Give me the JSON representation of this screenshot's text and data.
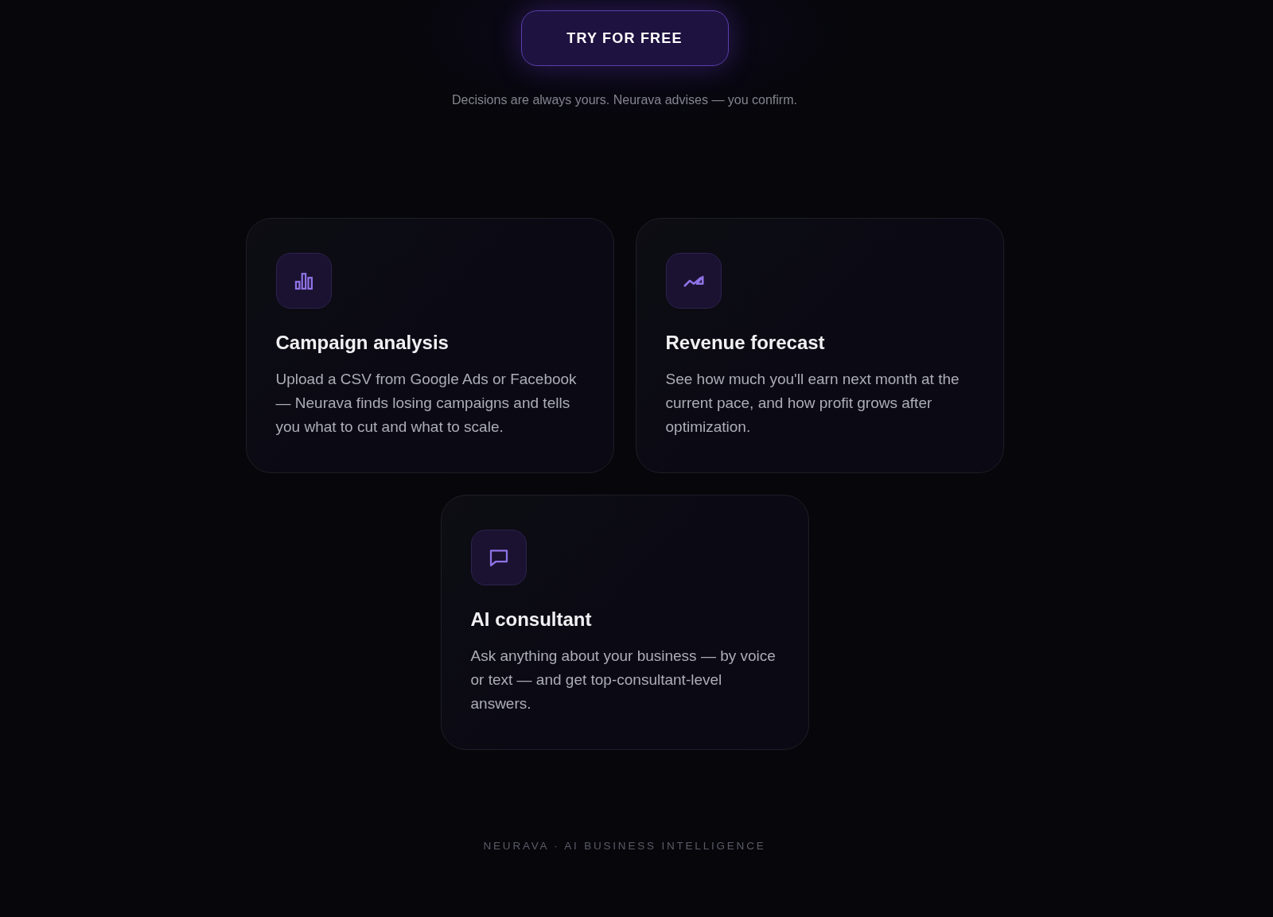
{
  "cta": {
    "label": "TRY FOR FREE"
  },
  "note": "Decisions are always yours. Neurava advises — you confirm.",
  "features": [
    {
      "kind": "analysis",
      "title": "Campaign analysis",
      "description": "Upload a CSV from Google Ads or Facebook — Neurava finds losing campaigns and tells you what to cut and what to scale."
    },
    {
      "kind": "forecast",
      "title": "Revenue forecast",
      "description": "See how much you'll earn next month at the current pace, and how profit grows after optimization."
    },
    {
      "kind": "consultant",
      "title": "AI consultant",
      "description": "Ask anything about your business — by voice or text — and get top-consultant-level answers."
    }
  ],
  "footer": "NEURAVA · AI BUSINESS INTELLIGENCE"
}
